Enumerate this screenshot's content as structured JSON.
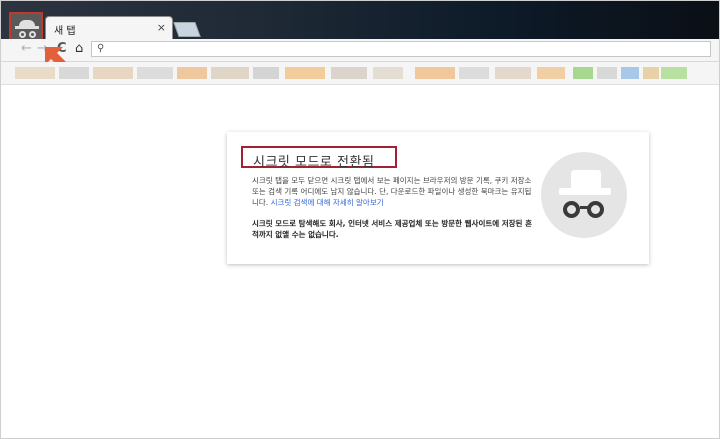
{
  "tab": {
    "title": "새 탭",
    "close": "×"
  },
  "toolbar": {
    "back": "←",
    "forward": "→",
    "reload": "C",
    "home": "⌂",
    "search_icon": "⚲",
    "omnibox_value": ""
  },
  "icons": {
    "incognito_tab": "incognito-icon",
    "arrow": "pointer-arrow-icon"
  },
  "colors": {
    "highlight": "#a32232",
    "arrow": "#e2603a",
    "link": "#3367d6"
  },
  "card": {
    "title": "시크릿 모드로 전환됨",
    "p1_text": "시크릿 탭을 모두 닫으면 시크릿 탭에서 보는 페이지는 브라우저의 방문 기록, 쿠키 저장소 또는 검색 기록 어디에도 남지 않습니다. 단, 다운로드한 파일이나 생성한 북마크는 유지됩니다.",
    "p1_link": "시크릿 검색에 대해 자세히 알아보기",
    "p2_text": "시크릿 모드로 탐색해도 회사, 인터넷 서비스 제공업체 또는 방문한 웹사이트에 저장된 흔적까지 없앨 수는 없습니다."
  }
}
